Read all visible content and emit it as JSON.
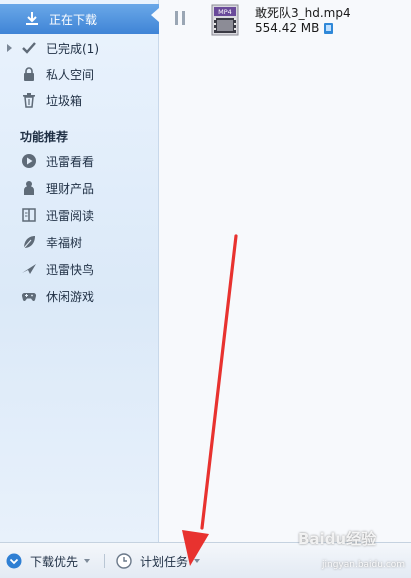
{
  "sidebar": {
    "items": [
      {
        "label": "正在下载",
        "icon": "download-icon"
      },
      {
        "label": "已完成(1)",
        "icon": "checkmark-icon"
      },
      {
        "label": "私人空间",
        "icon": "lock-icon"
      },
      {
        "label": "垃圾箱",
        "icon": "trash-icon"
      }
    ],
    "section_title": "功能推荐",
    "features": [
      {
        "label": "迅雷看看",
        "icon": "play-icon"
      },
      {
        "label": "理财产品",
        "icon": "coins-icon"
      },
      {
        "label": "迅雷阅读",
        "icon": "book-icon"
      },
      {
        "label": "幸福树",
        "icon": "leaf-icon"
      },
      {
        "label": "迅雷快鸟",
        "icon": "bird-icon"
      },
      {
        "label": "休闲游戏",
        "icon": "gamepad-icon"
      }
    ]
  },
  "task": {
    "file_name": "敢死队3_hd.mp4",
    "file_size": "554.42 MB",
    "file_type_label": "MP4"
  },
  "statusbar": {
    "download_priority": "下载优先",
    "scheduled_task": "计划任务"
  },
  "watermark": {
    "brand": "Baidu经验",
    "url": "jingyan.baidu.com"
  },
  "colors": {
    "accent": "#3f84d6",
    "arrow": "#e8322f",
    "sidebar_bg": "#dbe9f8"
  }
}
